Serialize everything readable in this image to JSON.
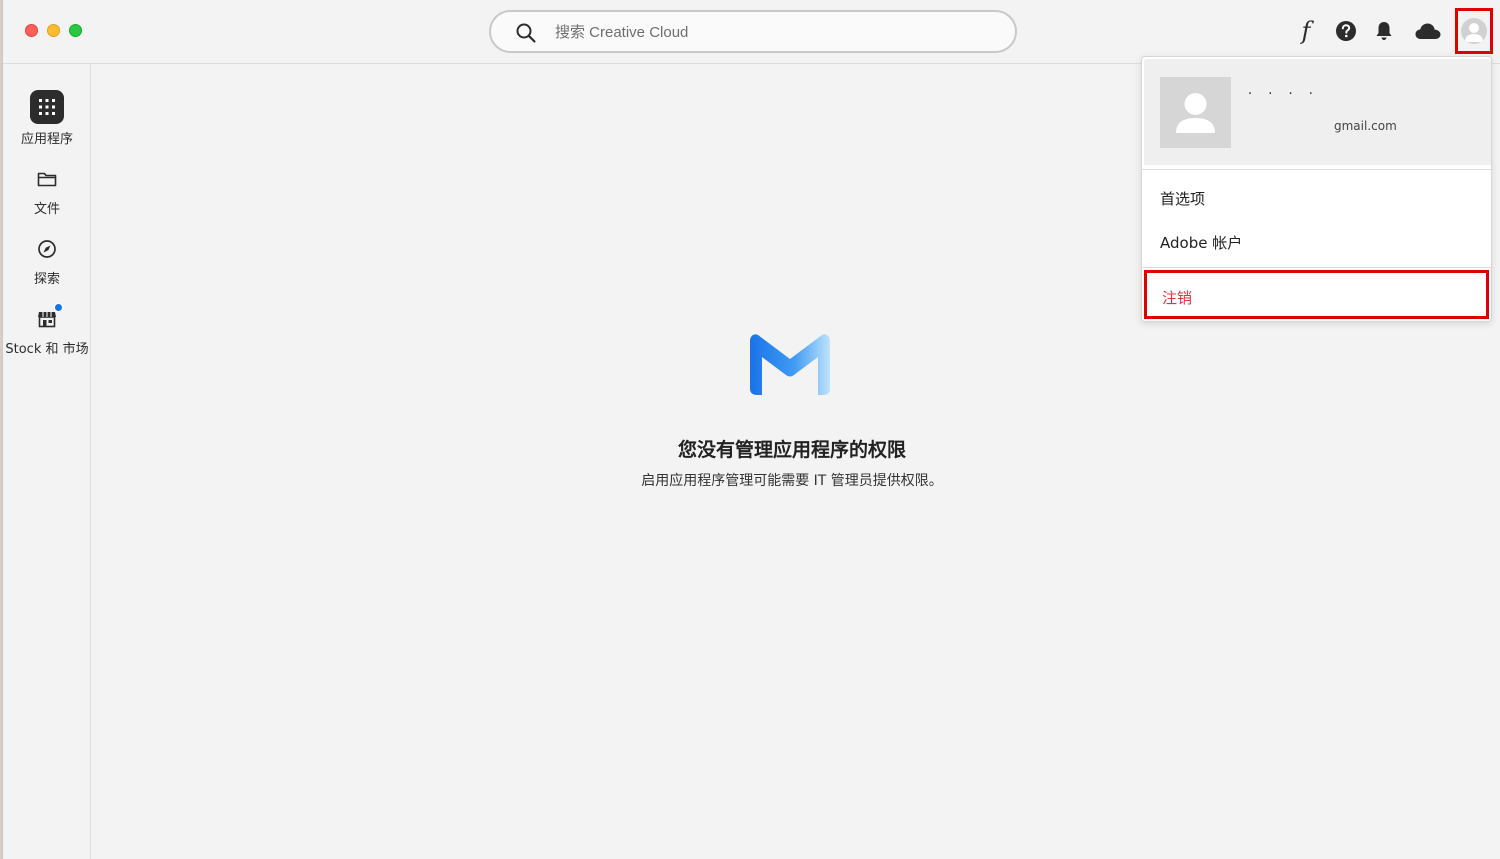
{
  "search": {
    "placeholder": "搜索 Creative Cloud"
  },
  "toolbar": {
    "fonts_glyph": "f"
  },
  "sidebar": {
    "items": [
      {
        "label": "应用程序",
        "icon": "apps-grid-icon"
      },
      {
        "label": "文件",
        "icon": "folder-icon"
      },
      {
        "label": "探索",
        "icon": "compass-icon"
      },
      {
        "label": "Stock 和 市场",
        "icon": "stock-market-icon"
      }
    ]
  },
  "main": {
    "title": "您没有管理应用程序的权限",
    "description": "启用应用程序管理可能需要 IT 管理员提供权限。"
  },
  "account_menu": {
    "name": "· · · ·",
    "email": "gmail.com",
    "items": [
      {
        "label": "首选项"
      },
      {
        "label": "Adobe 帐户"
      },
      {
        "label": "注销"
      }
    ]
  },
  "colors": {
    "highlight": "#e10000",
    "signout_text": "#d7373f",
    "logo_blue": "#1a73e8",
    "notification_dot": "#1473e6"
  }
}
